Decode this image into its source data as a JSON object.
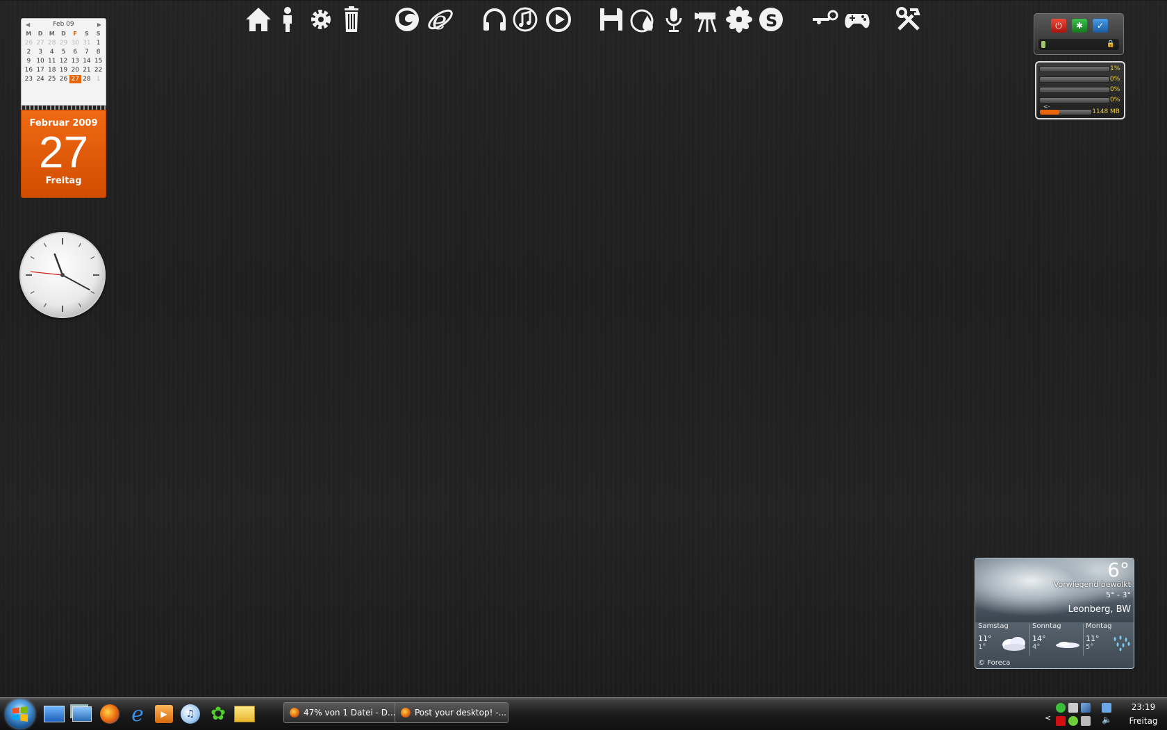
{
  "dock": {
    "icons": [
      "home-icon",
      "user-icon",
      "settings-gear-icon",
      "trash-icon",
      "firefox-icon",
      "internet-explorer-icon",
      "headphones-icon",
      "itunes-icon",
      "media-player-icon",
      "save-floppy-icon",
      "burner-flame-icon",
      "microphone-icon",
      "video-camera-icon",
      "icq-flower-icon",
      "skype-icon",
      "steam-icon",
      "gamepad-icon",
      "tools-icon"
    ]
  },
  "calendar": {
    "header": "Feb 09",
    "weekdays": [
      "M",
      "D",
      "M",
      "D",
      "F",
      "S",
      "S"
    ],
    "weeks": [
      [
        "26",
        "27",
        "28",
        "29",
        "30",
        "31",
        "1"
      ],
      [
        "2",
        "3",
        "4",
        "5",
        "6",
        "7",
        "8"
      ],
      [
        "9",
        "10",
        "11",
        "12",
        "13",
        "14",
        "15"
      ],
      [
        "16",
        "17",
        "18",
        "19",
        "20",
        "21",
        "22"
      ],
      [
        "23",
        "24",
        "25",
        "26",
        "27",
        "28",
        "1"
      ]
    ],
    "today": "27",
    "month_year": "Februar 2009",
    "day_number": "27",
    "weekday": "Freitag"
  },
  "clock": {
    "hour": 11,
    "minute": 19,
    "second": 46
  },
  "system_meter": {
    "cpu": [
      "1%",
      "0%",
      "0%",
      "0%"
    ],
    "cpu_levels": [
      0.01,
      0,
      0,
      0
    ],
    "arrow": "<-",
    "memory": "1148 MB",
    "memory_level": 0.38,
    "accent": "#f1d23a"
  },
  "power_gadget": {
    "buttons": [
      {
        "icon": "power-icon",
        "color": "#d6281b"
      },
      {
        "icon": "restart-icon",
        "color": "#1f9b2c"
      },
      {
        "icon": "sleep-check-icon",
        "color": "#2a76c6"
      }
    ]
  },
  "weather": {
    "temp": "6°",
    "condition": "Vorwiegend bewölkt",
    "range": "5° - 3°",
    "location": "Leonberg, BW",
    "forecast": [
      {
        "day": "Samstag",
        "hi": "11°",
        "lo": "1°",
        "icon": "cloudy-icon"
      },
      {
        "day": "Sonntag",
        "hi": "14°",
        "lo": "4°",
        "icon": "partly-cloudy-icon"
      },
      {
        "day": "Montag",
        "hi": "11°",
        "lo": "5°",
        "icon": "rain-icon"
      }
    ],
    "source": "© Foreca"
  },
  "taskbar": {
    "quick_launch": [
      "show-desktop-icon",
      "switch-windows-icon",
      "firefox-icon",
      "internet-explorer-icon",
      "media-center-icon",
      "itunes-icon",
      "icq-icon",
      "mail-icon"
    ],
    "windows": [
      {
        "label": "47% von 1 Datei - D..."
      },
      {
        "label": "Post your desktop! -..."
      }
    ],
    "time": "23:19",
    "day": "Freitag",
    "tray_arrow": "<"
  }
}
